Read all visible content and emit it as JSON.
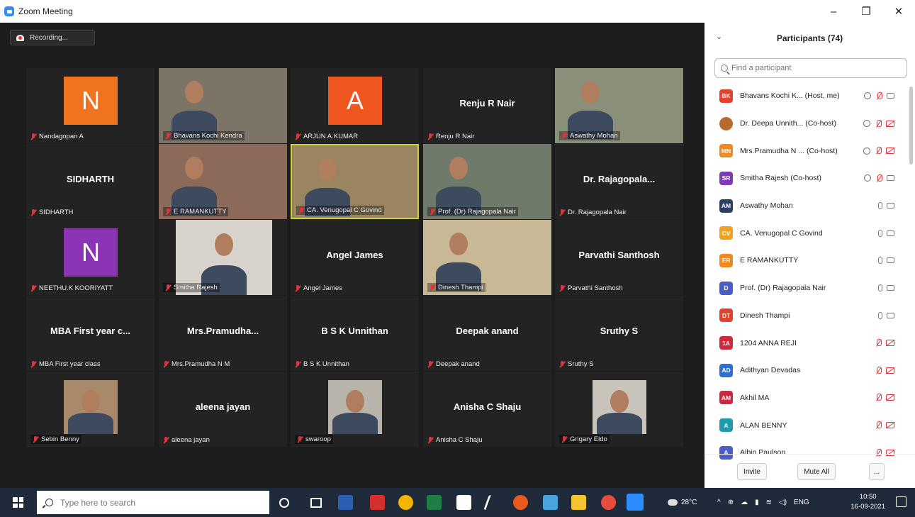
{
  "window": {
    "title": "Zoom Meeting",
    "minimize": "–",
    "restore": "❐",
    "close": "✕"
  },
  "recording": {
    "label": "Recording..."
  },
  "tiles": [
    {
      "label": "Nandagopan A",
      "type": "avatar",
      "letter": "N",
      "color": "#f0731f"
    },
    {
      "label": "Bhavans Kochi Kendra",
      "type": "video"
    },
    {
      "label": "ARJUN A.KUMAR",
      "type": "avatar",
      "letter": "A",
      "color": "#f0561f"
    },
    {
      "label": "Renju R Nair",
      "type": "name",
      "display": "Renju R Nair"
    },
    {
      "label": "Aswathy Mohan",
      "type": "video"
    },
    {
      "label": "SIDHARTH",
      "type": "name",
      "display": "SIDHARTH"
    },
    {
      "label": "E RAMANKUTTY",
      "type": "video"
    },
    {
      "label": "CA. Venugopal C Govind",
      "type": "video",
      "active": true
    },
    {
      "label": "Prof. (Dr) Rajagopala Nair",
      "type": "video"
    },
    {
      "label": "Dr. Rajagopala Nair",
      "type": "name",
      "display": "Dr.  Rajagopala..."
    },
    {
      "label": "NEETHU.K KOORIYATT",
      "type": "avatar",
      "letter": "N",
      "color": "#8b35b5"
    },
    {
      "label": "Smitha Rajesh",
      "type": "video"
    },
    {
      "label": "Angel James",
      "type": "name",
      "display": "Angel James"
    },
    {
      "label": "Dinesh Thampi",
      "type": "video"
    },
    {
      "label": "Parvathi Santhosh",
      "type": "name",
      "display": "Parvathi Santhosh"
    },
    {
      "label": "MBA First year class",
      "type": "name",
      "display": "MBA First year c..."
    },
    {
      "label": "Mrs.Pramudha N M",
      "type": "name",
      "display": "Mrs.Pramudha..."
    },
    {
      "label": "B S K Unnithan",
      "type": "name",
      "display": "B S K Unnithan"
    },
    {
      "label": "Deepak anand",
      "type": "name",
      "display": "Deepak anand"
    },
    {
      "label": "Sruthy S",
      "type": "name",
      "display": "Sruthy S"
    },
    {
      "label": "Sebin Benny",
      "type": "video"
    },
    {
      "label": "aleena jayan",
      "type": "name",
      "display": "aleena jayan"
    },
    {
      "label": "swaroop",
      "type": "video"
    },
    {
      "label": "Anisha C Shaju",
      "type": "name",
      "display": "Anisha C Shaju"
    },
    {
      "label": "Grigary Eldo",
      "type": "video"
    }
  ],
  "participants": {
    "title": "Participants (74)",
    "search_placeholder": "Find a participant",
    "list": [
      {
        "initials": "BK",
        "color": "#e2422b",
        "name": "Bhavans Kochi K... (Host, me)",
        "share": true,
        "mic": "off",
        "cam": "on"
      },
      {
        "initials": "",
        "color": "#b86b2c",
        "name": "Dr. Deepa Unnith... (Co-host)",
        "share": true,
        "mic": "off",
        "cam": "off",
        "photo": true
      },
      {
        "initials": "MN",
        "color": "#f08a1f",
        "name": "Mrs.Pramudha N ... (Co-host)",
        "share": true,
        "mic": "off",
        "cam": "off"
      },
      {
        "initials": "SR",
        "color": "#7a3db5",
        "name": "Smitha Rajesh (Co-host)",
        "share": true,
        "mic": "off",
        "cam": "on"
      },
      {
        "initials": "AM",
        "color": "#2d3e66",
        "name": "Aswathy Mohan",
        "share": false,
        "mic": "on",
        "cam": "on"
      },
      {
        "initials": "CV",
        "color": "#f0a21f",
        "name": "CA. Venugopal C Govind",
        "share": false,
        "mic": "on",
        "cam": "on"
      },
      {
        "initials": "ER",
        "color": "#f08a1f",
        "name": "E RAMANKUTTY",
        "share": false,
        "mic": "on",
        "cam": "on"
      },
      {
        "initials": "D",
        "color": "#4a5ec8",
        "name": "Prof. (Dr) Rajagopala Nair",
        "share": false,
        "mic": "on",
        "cam": "on"
      },
      {
        "initials": "DT",
        "color": "#e2422b",
        "name": "Dinesh Thampi",
        "share": false,
        "mic": "on",
        "cam": "on"
      },
      {
        "initials": "1A",
        "color": "#d0283a",
        "name": "1204  ANNA REJI",
        "share": false,
        "mic": "off",
        "cam": "off"
      },
      {
        "initials": "AD",
        "color": "#2d6fd1",
        "name": "Adithyan Devadas",
        "share": false,
        "mic": "off",
        "cam": "off"
      },
      {
        "initials": "AM",
        "color": "#d0283a",
        "name": "Akhil MA",
        "share": false,
        "mic": "off",
        "cam": "off"
      },
      {
        "initials": "A",
        "color": "#1f9bb0",
        "name": "ALAN BENNY",
        "share": false,
        "mic": "off",
        "cam": "off"
      },
      {
        "initials": "A",
        "color": "#4a5ec8",
        "name": "Albin Paulson",
        "share": false,
        "mic": "off",
        "cam": "off"
      }
    ],
    "invite": "Invite",
    "mute_all": "Mute All",
    "more": "..."
  },
  "taskbar": {
    "search_placeholder": "Type here to search",
    "weather": "28°C",
    "lang": "ENG",
    "time": "10:50",
    "date": "16-09-2021"
  },
  "colors": {
    "accent": "#2d8cff",
    "muted": "#e0333a",
    "active_speaker": "#c9d23a"
  }
}
